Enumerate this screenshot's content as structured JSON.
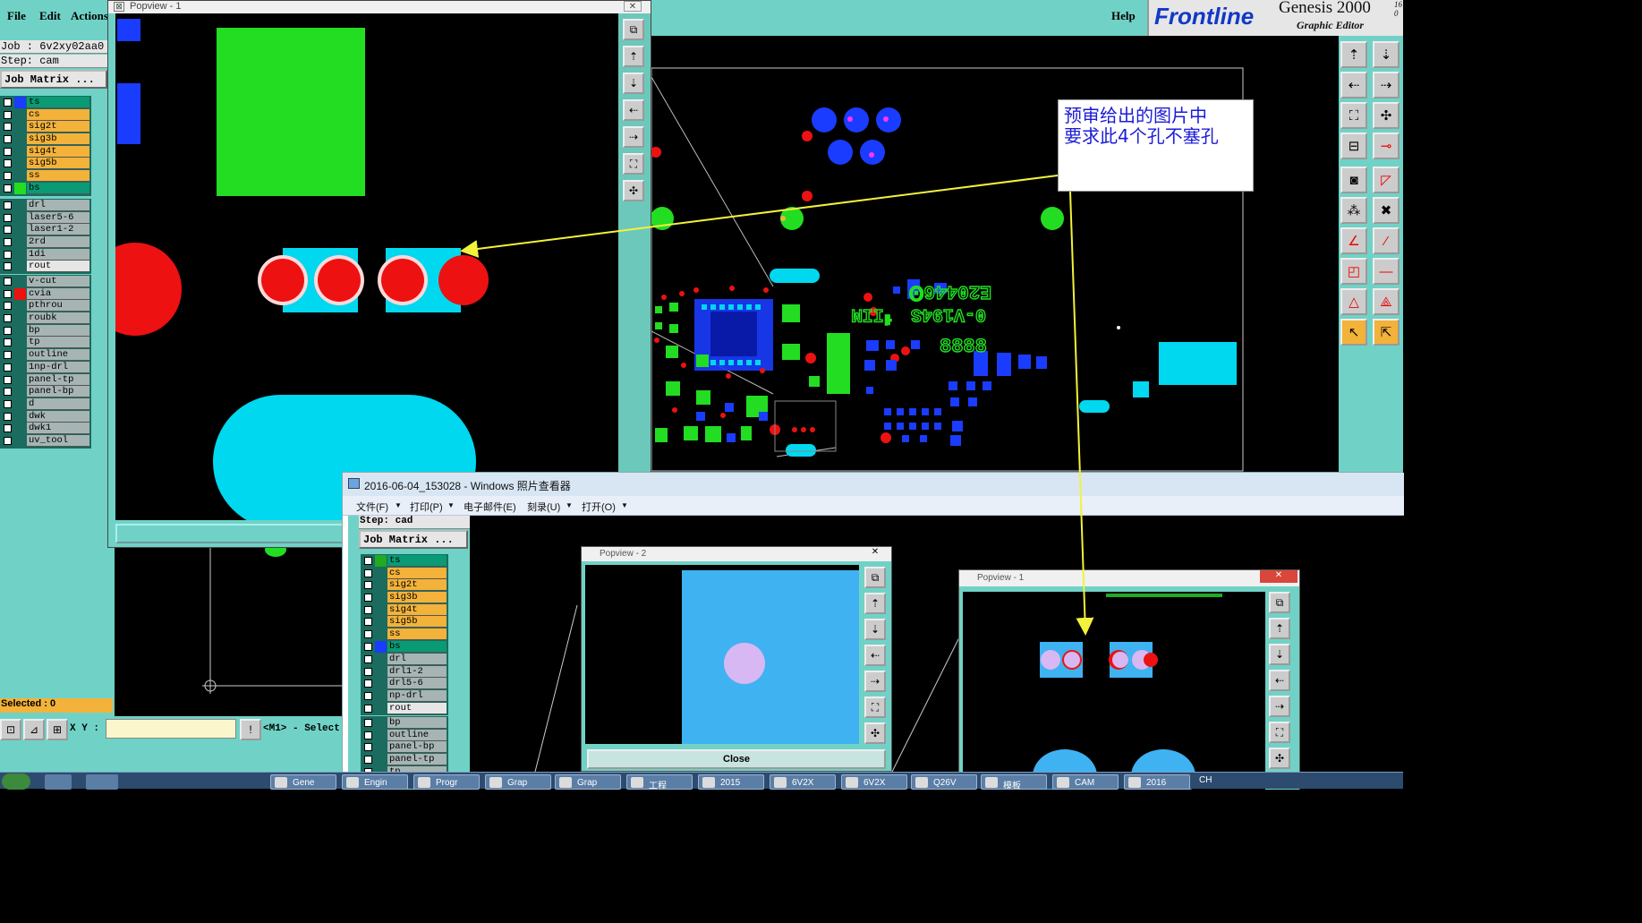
{
  "menus": {
    "file": "File",
    "edit": "Edit",
    "actions": "Actions",
    "help": "Help"
  },
  "brand": {
    "logo": "Frontline",
    "product": "Genesis 2000",
    "subtitle": "Graphic Editor",
    "version_fragment": "16 0"
  },
  "job_info": {
    "job": "Job :  6v2xy02aa0",
    "step": "Step: cam",
    "job_matrix": "Job Matrix ..."
  },
  "layers_top": [
    {
      "name": "ts",
      "color": "#0a9a75",
      "swatch": "#1a3cff"
    },
    {
      "name": "cs",
      "color": "#f3b23a",
      "swatch": ""
    },
    {
      "name": "sig2t",
      "color": "#f3b23a",
      "swatch": ""
    },
    {
      "name": "sig3b",
      "color": "#f3b23a",
      "swatch": ""
    },
    {
      "name": "sig4t",
      "color": "#f3b23a",
      "swatch": ""
    },
    {
      "name": "sig5b",
      "color": "#f3b23a",
      "swatch": ""
    },
    {
      "name": "ss",
      "color": "#f3b23a",
      "swatch": ""
    },
    {
      "name": "bs",
      "color": "#0a9a75",
      "swatch": "#22dd22"
    }
  ],
  "layers_drill": [
    "drl",
    "laser5-6",
    "laser1-2",
    "2rd",
    "1di",
    "rout"
  ],
  "layers_misc": [
    {
      "name": "v-cut",
      "swatch": ""
    },
    {
      "name": "cvia",
      "swatch": "#ee1111"
    },
    {
      "name": "pthrou",
      "swatch": ""
    },
    {
      "name": "roubk",
      "swatch": ""
    },
    {
      "name": "bp",
      "swatch": ""
    },
    {
      "name": "tp",
      "swatch": ""
    },
    {
      "name": "outline",
      "swatch": ""
    },
    {
      "name": "1np-drl",
      "swatch": ""
    },
    {
      "name": "panel-tp",
      "swatch": ""
    },
    {
      "name": "panel-bp",
      "swatch": ""
    },
    {
      "name": "d",
      "swatch": ""
    },
    {
      "name": "dwk",
      "swatch": ""
    },
    {
      "name": "dwk1",
      "swatch": ""
    },
    {
      "name": "uv_tool",
      "swatch": ""
    }
  ],
  "status": {
    "selected": "Selected : 0",
    "xy_label": "X Y :",
    "xy_value": "",
    "mouse_hint": "<M1> - Select"
  },
  "popview1": {
    "title": "Popview - 1"
  },
  "callout": {
    "line1": "预审给出的图片中",
    "line2": "要求此4个孔不塞孔"
  },
  "board_text": {
    "line1": "E20446Ꙩ",
    "line2": "0-V194S ᅦIIM",
    "line3": "8888"
  },
  "photo_viewer": {
    "title": "2016-06-04_153028 - Windows 照片查看器",
    "menu": [
      "文件(F)",
      "打印(P)",
      "电子邮件(E)",
      "刻录(U)",
      "打开(O)"
    ],
    "inner_step": "Step: cad",
    "inner_job_matrix": "Job Matrix ...",
    "inner_layers_top": [
      "ts",
      "cs",
      "sig2t",
      "sig3b",
      "sig4t",
      "sig5b",
      "ss",
      "bs"
    ],
    "inner_layers_drill": [
      "drl",
      "drl1-2",
      "drl5-6",
      "np-drl",
      "rout"
    ],
    "inner_layers_misc": [
      "bp",
      "outline",
      "panel-bp",
      "panel-tp",
      "tp"
    ],
    "popview2_title": "Popview - 2",
    "popview2_close": "Close",
    "popview1_title": "Popview - 1"
  },
  "taskbar": [
    "Gene",
    "Engin",
    "Progr",
    "Grap",
    "Grap",
    "工程",
    "2015",
    "6V2X",
    "6V2X",
    "Q26V",
    "模板",
    "CAM",
    "2016"
  ],
  "tray": "CH"
}
